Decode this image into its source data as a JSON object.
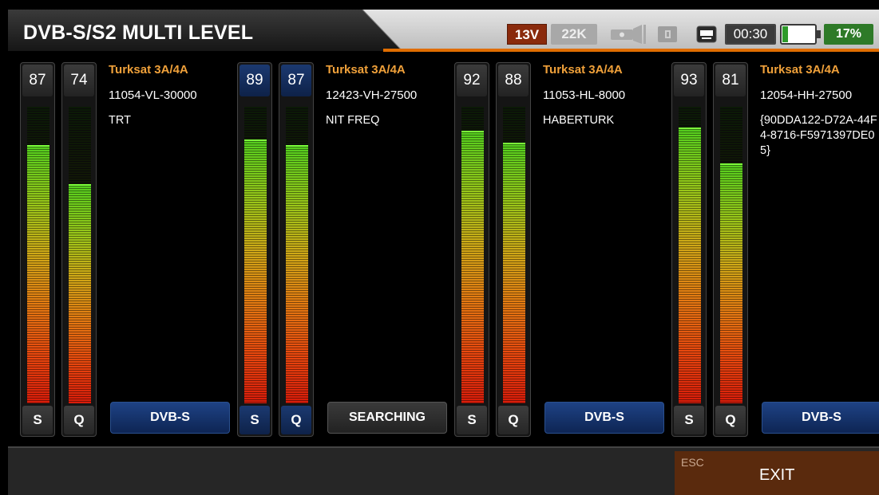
{
  "header": {
    "title": "DVB-S/S2 MULTI LEVEL",
    "lnb_voltage": "13V",
    "tone": "22K",
    "time": "00:30",
    "battery": "17%",
    "battery_level": 0.17,
    "icons": [
      "flashlight-icon",
      "sd-card-icon",
      "keyboard-icon",
      "battery-icon"
    ]
  },
  "colors": {
    "accent": "#e06d00",
    "satellite_name": "#f0a13a",
    "button_blue": "#1e4284",
    "exit_button": "#5a2a0d"
  },
  "groups": [
    {
      "satellite": "Turksat 3A/4A",
      "transponder": "11054-VL-30000",
      "service": "TRT",
      "standard": "DVB-S",
      "standard_style": "blue",
      "highlighted": false,
      "meters": [
        {
          "label": "S",
          "value": "87"
        },
        {
          "label": "Q",
          "value": "74"
        }
      ]
    },
    {
      "satellite": "Turksat 3A/4A",
      "transponder": "12423-VH-27500",
      "service": "NIT FREQ",
      "standard": "SEARCHING",
      "standard_style": "gray",
      "highlighted": true,
      "meters": [
        {
          "label": "S",
          "value": "89"
        },
        {
          "label": "Q",
          "value": "87"
        }
      ]
    },
    {
      "satellite": "Turksat 3A/4A",
      "transponder": "11053-HL-8000",
      "service": "HABERTURK",
      "standard": "DVB-S",
      "standard_style": "blue",
      "highlighted": false,
      "meters": [
        {
          "label": "S",
          "value": "92"
        },
        {
          "label": "Q",
          "value": "88"
        }
      ]
    },
    {
      "satellite": "Turksat 3A/4A",
      "transponder": "12054-HH-27500",
      "service": "{90DDA122-D72A-44F4-8716-F5971397DE05}",
      "standard": "DVB-S",
      "standard_style": "blue",
      "highlighted": false,
      "meters": [
        {
          "label": "S",
          "value": "93"
        },
        {
          "label": "Q",
          "value": "81"
        }
      ]
    }
  ],
  "footer": {
    "esc": "ESC",
    "exit": "EXIT"
  }
}
